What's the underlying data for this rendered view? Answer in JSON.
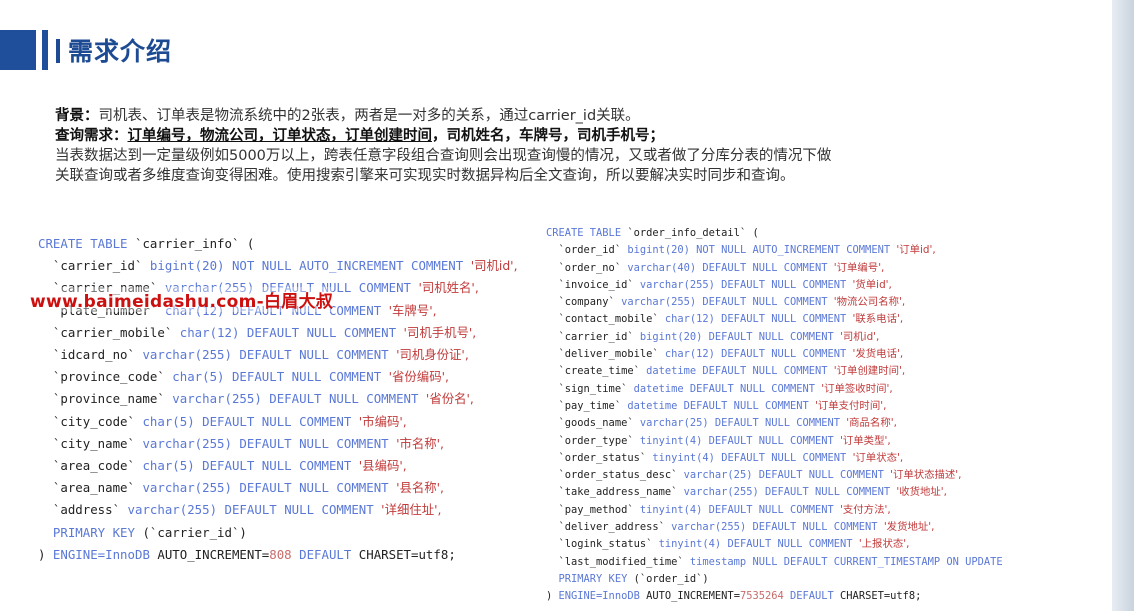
{
  "title": "需求介绍",
  "description": {
    "background_label": "背景：",
    "background_text": "司机表、订单表是物流系统中的2张表，两者是一对多的关系，通过carrier_id关联。",
    "query_label": "查询需求：",
    "query_underlined": "订单编号，物流公司，订单状态，订单创建时间",
    "query_rest": "，司机姓名，车牌号，司机手机号；",
    "line3": "当表数据达到一定量级例如5000万以上，跨表任意字段组合查询则会出现查询慢的情况，又或者做了分库分表的情况下做",
    "line4": "关联查询或者多维度查询变得困难。使用搜索引擎来可实现实时数据异构后全文查询，所以要解决实时同步和查询。"
  },
  "watermark": "www.baimeidashu.com-白眉大叔",
  "left_table": {
    "create": "CREATE TABLE `carrier_info` (",
    "columns": [
      {
        "name": "`carrier_id`",
        "type": "bigint(20)",
        "constraint": "NOT NULL AUTO_INCREMENT COMMENT",
        "comment": "'司机id',"
      },
      {
        "name": "`carrier_name`",
        "type": "varchar(255)",
        "constraint": "DEFAULT NULL COMMENT",
        "comment": "'司机姓名',"
      },
      {
        "name": "`plate_number`",
        "type": "char(12)",
        "constraint": "DEFAULT NULL COMMENT",
        "comment": "'车牌号',"
      },
      {
        "name": "`carrier_mobile`",
        "type": "char(12)",
        "constraint": "DEFAULT NULL COMMENT",
        "comment": "'司机手机号',"
      },
      {
        "name": "`idcard_no`",
        "type": "varchar(255)",
        "constraint": "DEFAULT NULL COMMENT",
        "comment": "'司机身份证',"
      },
      {
        "name": "`province_code`",
        "type": "char(5)",
        "constraint": "DEFAULT NULL COMMENT",
        "comment": "'省份编码',"
      },
      {
        "name": "`province_name`",
        "type": "varchar(255)",
        "constraint": "DEFAULT NULL COMMENT",
        "comment": "'省份名',"
      },
      {
        "name": "`city_code`",
        "type": "char(5)",
        "constraint": "DEFAULT NULL COMMENT",
        "comment": "'市编码',"
      },
      {
        "name": "`city_name`",
        "type": "varchar(255)",
        "constraint": "DEFAULT NULL COMMENT",
        "comment": "'市名称',"
      },
      {
        "name": "`area_code`",
        "type": "char(5)",
        "constraint": "DEFAULT NULL COMMENT",
        "comment": "'县编码',"
      },
      {
        "name": "`area_name`",
        "type": "varchar(255)",
        "constraint": "DEFAULT NULL COMMENT",
        "comment": "'县名称',"
      },
      {
        "name": "`address`",
        "type": "varchar(255)",
        "constraint": "DEFAULT NULL COMMENT",
        "comment": "'详细住址',"
      }
    ],
    "primary_key_kw": "PRIMARY KEY",
    "primary_key_col": "(`carrier_id`)",
    "engine_kw": "ENGINE=InnoDB",
    "auto_increment": "AUTO_INCREMENT=",
    "auto_increment_val": "808",
    "default_kw": "DEFAULT",
    "charset": "CHARSET=utf8;"
  },
  "right_table": {
    "create": "CREATE TABLE `order_info_detail` (",
    "columns": [
      {
        "name": "`order_id`",
        "type": "bigint(20)",
        "constraint": "NOT NULL AUTO_INCREMENT COMMENT",
        "comment": "'订单id',"
      },
      {
        "name": "`order_no`",
        "type": "varchar(40)",
        "constraint": "DEFAULT NULL COMMENT",
        "comment": "'订单编号',"
      },
      {
        "name": "`invoice_id`",
        "type": "varchar(255)",
        "constraint": "DEFAULT NULL COMMENT",
        "comment": "'货单id',"
      },
      {
        "name": "`company`",
        "type": "varchar(255)",
        "constraint": "DEFAULT NULL COMMENT",
        "comment": "'物流公司名称',"
      },
      {
        "name": "`contact_mobile`",
        "type": "char(12)",
        "constraint": "DEFAULT NULL COMMENT",
        "comment": "'联系电话',"
      },
      {
        "name": "`carrier_id`",
        "type": "bigint(20)",
        "constraint": "DEFAULT NULL COMMENT",
        "comment": "'司机id',"
      },
      {
        "name": "`deliver_mobile`",
        "type": "char(12)",
        "constraint": "DEFAULT NULL COMMENT",
        "comment": "'发货电话',"
      },
      {
        "name": "`create_time`",
        "type": "datetime",
        "constraint": "DEFAULT NULL COMMENT",
        "comment": "'订单创建时间',"
      },
      {
        "name": "`sign_time`",
        "type": "datetime",
        "constraint": "DEFAULT NULL COMMENT",
        "comment": "'订单签收时间',"
      },
      {
        "name": "`pay_time`",
        "type": "datetime",
        "constraint": "DEFAULT NULL COMMENT",
        "comment": "'订单支付时间',"
      },
      {
        "name": "`goods_name`",
        "type": "varchar(25)",
        "constraint": "DEFAULT NULL COMMENT",
        "comment": "'商品名称',"
      },
      {
        "name": "`order_type`",
        "type": "tinyint(4)",
        "constraint": "DEFAULT NULL COMMENT",
        "comment": "'订单类型',"
      },
      {
        "name": "`order_status`",
        "type": "tinyint(4)",
        "constraint": "DEFAULT NULL COMMENT",
        "comment": "'订单状态',"
      },
      {
        "name": "`order_status_desc`",
        "type": "varchar(25)",
        "constraint": "DEFAULT NULL COMMENT",
        "comment": "'订单状态描述',"
      },
      {
        "name": "`take_address_name`",
        "type": "varchar(255)",
        "constraint": "DEFAULT NULL COMMENT",
        "comment": "'收货地址',"
      },
      {
        "name": "`pay_method`",
        "type": "tinyint(4)",
        "constraint": "DEFAULT NULL COMMENT",
        "comment": "'支付方法',"
      },
      {
        "name": "`deliver_address`",
        "type": "varchar(255)",
        "constraint": "DEFAULT NULL COMMENT",
        "comment": "'发货地址',"
      },
      {
        "name": "`logink_status`",
        "type": "tinyint(4)",
        "constraint": "DEFAULT NULL COMMENT",
        "comment": "'上报状态',"
      },
      {
        "name": "`last_modified_time`",
        "type": "timestamp",
        "constraint": "NULL DEFAULT CURRENT_TIMESTAMP ON UPDATE",
        "comment": ""
      }
    ],
    "primary_key_kw": "PRIMARY KEY",
    "primary_key_col": "(`order_id`)",
    "engine_kw": "ENGINE=InnoDB",
    "auto_increment": "AUTO_INCREMENT=",
    "auto_increment_val": "7535264",
    "default_kw": "DEFAULT",
    "charset": "CHARSET=utf8;"
  }
}
